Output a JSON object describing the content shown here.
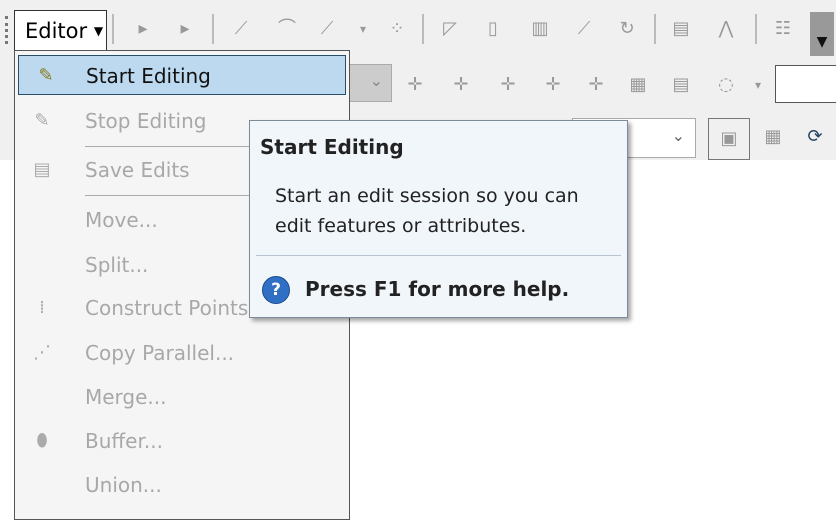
{
  "editor_menu": {
    "label": "Editor",
    "items": [
      {
        "label": "Start Editing",
        "icon": "pencil-start-icon",
        "enabled": true,
        "highlighted": true
      },
      {
        "label": "Stop Editing",
        "icon": "pencil-stop-icon",
        "enabled": false
      },
      {
        "label": "Save Edits",
        "icon": "save-icon",
        "enabled": false
      },
      {
        "label": "Move...",
        "icon": "",
        "enabled": false
      },
      {
        "label": "Split...",
        "icon": "",
        "enabled": false
      },
      {
        "label": "Construct Points...",
        "icon": "construct-points-icon",
        "enabled": false
      },
      {
        "label": "Copy Parallel...",
        "icon": "copy-parallel-icon",
        "enabled": false
      },
      {
        "label": "Merge...",
        "icon": "",
        "enabled": false
      },
      {
        "label": "Buffer...",
        "icon": "buffer-icon",
        "enabled": false
      },
      {
        "label": "Union...",
        "icon": "",
        "enabled": false
      }
    ]
  },
  "tooltip": {
    "title": "Start Editing",
    "description": "Start an edit session so you can edit features or attributes.",
    "help": "Press F1 for more help.",
    "help_icon": "question-icon"
  },
  "colors": {
    "highlight": "#bcd9ef",
    "tooltip_bg": "#f1f6fb",
    "help_icon": "#2f6fc4"
  }
}
